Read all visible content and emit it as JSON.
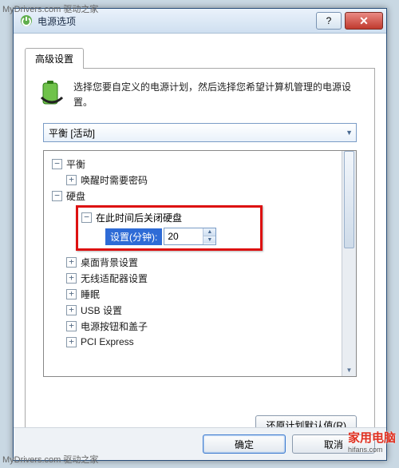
{
  "watermark": "MyDrivers.com 驱动之家",
  "title": "电源选项",
  "help_glyph": "?",
  "close_glyph": "✕",
  "tab": "高级设置",
  "desc": "选择您要自定义的电源计划，然后选择您希望计算机管理的电源设置。",
  "plan": "平衡 [活动]",
  "tree": {
    "balance": "平衡",
    "wake_pw": "唤醒时需要密码",
    "hdd": "硬盘",
    "hdd_off": "在此时间后关闭硬盘",
    "setting_label": "设置(分钟):",
    "setting_value": "20",
    "desktop_bg": "桌面背景设置",
    "wifi": "无线适配器设置",
    "sleep": "睡眠",
    "usb": "USB 设置",
    "power_button": "电源按钮和盖子",
    "pci": "PCI Express"
  },
  "restore": "还原计划默认值(R)",
  "ok": "确定",
  "cancel": "取消",
  "stamp_top": "家用电脑",
  "stamp_sub": "hifans.com"
}
